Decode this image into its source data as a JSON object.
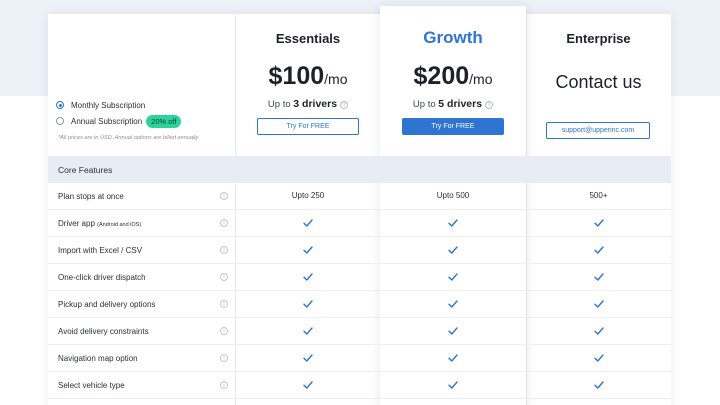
{
  "billing": {
    "monthly_label": "Monthly Subscription",
    "annual_label": "Annual Subscription",
    "annual_badge": "20% off",
    "selected": "monthly",
    "note": "*All prices are in USD. Annual options are billed annually"
  },
  "plans": [
    {
      "name": "Essentials",
      "price": "$100",
      "unit": "/mo",
      "drivers_prefix": "Up to ",
      "drivers_value": "3 drivers",
      "cta": "Try For FREE"
    },
    {
      "name": "Growth",
      "price": "$200",
      "unit": "/mo",
      "drivers_prefix": "Up to ",
      "drivers_value": "5 drivers",
      "cta": "Try For FREE"
    },
    {
      "name": "Enterprise",
      "price": "Contact us",
      "cta": "support@upperinc.com"
    }
  ],
  "section_title": "Core Features",
  "features": [
    {
      "label": "Plan stops at once",
      "values": [
        "Upto 250",
        "Upto 500",
        "500+"
      ]
    },
    {
      "label": "Driver app",
      "note": "(Android and iOS)",
      "values": [
        "check",
        "check",
        "check"
      ]
    },
    {
      "label": "Import with Excel / CSV",
      "values": [
        "check",
        "check",
        "check"
      ]
    },
    {
      "label": "One-click driver dispatch",
      "values": [
        "check",
        "check",
        "check"
      ]
    },
    {
      "label": "Pickup and delivery options",
      "values": [
        "check",
        "check",
        "check"
      ]
    },
    {
      "label": "Avoid delivery constraints",
      "values": [
        "check",
        "check",
        "check"
      ]
    },
    {
      "label": "Navigation map option",
      "values": [
        "check",
        "check",
        "check"
      ]
    },
    {
      "label": "Select vehicle type",
      "values": [
        "check",
        "check",
        "check"
      ]
    }
  ],
  "info_glyph": "i",
  "colors": {
    "accent": "#2f74d0",
    "badge": "#2bd29a",
    "section_bg": "#e8edf5",
    "page_band": "#edf1f8"
  }
}
